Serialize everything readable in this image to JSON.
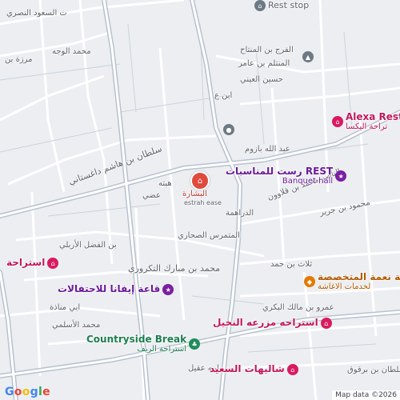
{
  "map": {
    "pois": [
      {
        "id": "rest-stop",
        "name": "",
        "sub": "Rest stop",
        "style": "gray"
      },
      {
        "id": "alexa",
        "name": "Alexa Rest Pla",
        "sub": "تراحة اليكسا",
        "style": "pink"
      },
      {
        "id": "rest-banquet",
        "name": "رست للمناسبات REST",
        "sub": "Banquet hall",
        "style": "purple"
      },
      {
        "id": "center",
        "name": "البشارة",
        "sub": "estrah ease",
        "style": "red"
      },
      {
        "id": "istiraha-left",
        "name": "استراحة",
        "sub": "",
        "style": "pink"
      },
      {
        "id": "qaat-iyfana",
        "name": "قاعة إيفانا للاحتفالات",
        "sub": "",
        "style": "purple"
      },
      {
        "id": "naema",
        "name": "شركة نعمة المتخصصة",
        "sub": "لخدمات الاغاشة",
        "style": "orange"
      },
      {
        "id": "nakheel",
        "name": "استراحه مزرعه النخيل",
        "sub": "",
        "style": "pink"
      },
      {
        "id": "countryside",
        "name": "Countryside Break",
        "sub": "استراحة الريف",
        "style": "green"
      },
      {
        "id": "shaleehat",
        "name": "شاليهات السعيد",
        "sub": "",
        "style": "pink"
      }
    ],
    "streets": [
      {
        "id": "s1",
        "text": "ت السعود النصري"
      },
      {
        "id": "s2",
        "text": "الفرج بن المنتاح"
      },
      {
        "id": "s3",
        "text": "المنتلم بن عامر"
      },
      {
        "id": "s4",
        "text": "حسين العيني"
      },
      {
        "id": "s5",
        "text": "محمد الوجه"
      },
      {
        "id": "s6",
        "text": "مرزة بن"
      },
      {
        "id": "s7",
        "text": "ابن ع"
      },
      {
        "id": "s8",
        "text": "عبد الله بازوم"
      },
      {
        "id": "s9",
        "text": "سلطان بن هاشم داغستاني"
      },
      {
        "id": "s10",
        "text": "الناصر محمد بن قلاوون"
      },
      {
        "id": "s11",
        "text": "محمود بن جرير"
      },
      {
        "id": "s12",
        "text": "المتمرس الصحاري"
      },
      {
        "id": "s13",
        "text": "الدراهمة"
      },
      {
        "id": "s14",
        "text": "بن الفضل الأربلي"
      },
      {
        "id": "s15",
        "text": "ثلاث بن حمد"
      },
      {
        "id": "s16",
        "text": "محمد بن مبارك التكروري"
      },
      {
        "id": "s17",
        "text": "عمرو بن مالك البكري"
      },
      {
        "id": "s18",
        "text": "ابي مناذة"
      },
      {
        "id": "s19",
        "text": "محمد الأسلمي"
      },
      {
        "id": "s20",
        "text": "ابيه عقيل"
      },
      {
        "id": "s21",
        "text": "السلطان بن برقوق"
      },
      {
        "id": "s22",
        "text": "هبته"
      },
      {
        "id": "s23",
        "text": "عضي"
      }
    ],
    "google_logo": [
      "G",
      "o",
      "o",
      "g",
      "l",
      "e"
    ],
    "attribution": "Map data ©2026"
  }
}
